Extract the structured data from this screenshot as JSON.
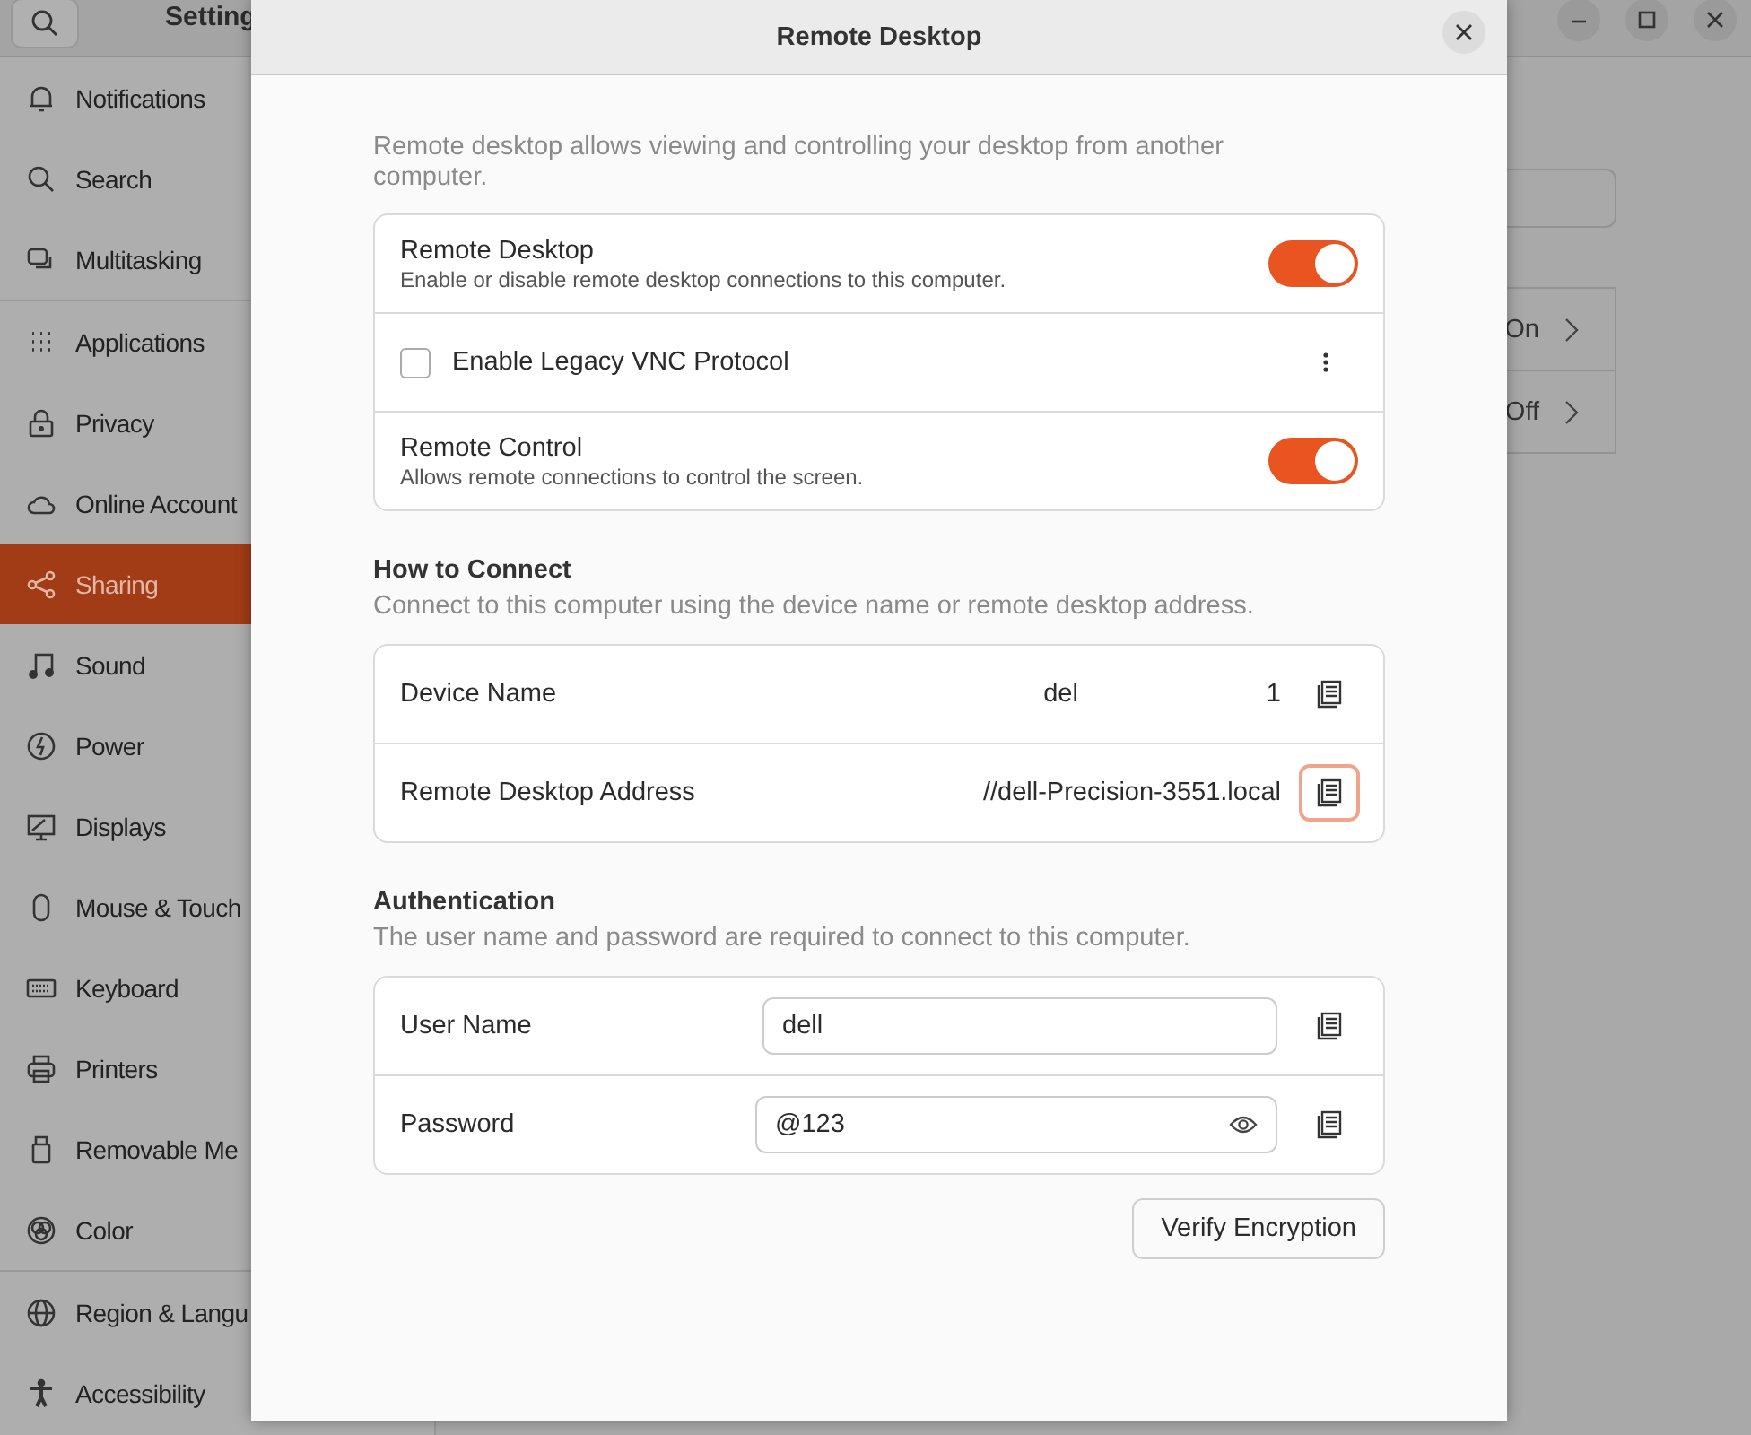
{
  "settings_window": {
    "title": "Setting",
    "sidebar": {
      "groups": [
        [
          {
            "label": "Notifications",
            "kind": "bell",
            "selected": false
          },
          {
            "label": "Search",
            "kind": "search",
            "selected": false
          },
          {
            "label": "Multitasking",
            "kind": "multitask",
            "selected": false
          }
        ],
        [
          {
            "label": "Applications",
            "kind": "grid",
            "selected": false
          },
          {
            "label": "Privacy",
            "kind": "lock",
            "selected": false
          },
          {
            "label": "Online Account",
            "kind": "cloud",
            "selected": false
          },
          {
            "label": "Sharing",
            "kind": "share",
            "selected": true
          },
          {
            "label": "Sound",
            "kind": "note",
            "selected": false
          },
          {
            "label": "Power",
            "kind": "power",
            "selected": false
          },
          {
            "label": "Displays",
            "kind": "display",
            "selected": false
          },
          {
            "label": "Mouse & Touch",
            "kind": "mouse",
            "selected": false
          },
          {
            "label": "Keyboard",
            "kind": "keyboard",
            "selected": false
          },
          {
            "label": "Printers",
            "kind": "printer",
            "selected": false
          },
          {
            "label": "Removable Me",
            "kind": "usb",
            "selected": false
          },
          {
            "label": "Color",
            "kind": "color",
            "selected": false
          }
        ],
        [
          {
            "label": "Region & Langu",
            "kind": "globe",
            "selected": false
          },
          {
            "label": "Accessibility",
            "kind": "person",
            "selected": false
          }
        ]
      ]
    },
    "panel_rows": [
      {
        "value": "On"
      },
      {
        "value": "Off"
      }
    ]
  },
  "dialog": {
    "title": "Remote Desktop",
    "intro": "Remote desktop allows viewing and controlling your desktop from another computer.",
    "options": [
      {
        "kind": "switch",
        "title": "Remote Desktop",
        "subtitle": "Enable or disable remote desktop connections to this computer.",
        "on": true
      },
      {
        "kind": "checkbox",
        "title": "Enable Legacy VNC Protocol",
        "checked": false
      },
      {
        "kind": "switch",
        "title": "Remote Control",
        "subtitle": "Allows remote connections to control the screen.",
        "on": true
      }
    ],
    "connect": {
      "heading": "How to Connect",
      "description": "Connect to this computer using the device name or remote desktop address.",
      "rows": [
        {
          "label": "Device Name",
          "value_parts": [
            "del",
            "1"
          ],
          "focused": false
        },
        {
          "label": "Remote Desktop Address",
          "value_parts": [
            "//dell-Precision-3551.local"
          ],
          "focused": true
        }
      ]
    },
    "auth": {
      "heading": "Authentication",
      "description": "The user name and password are required to connect to this computer.",
      "fields": [
        {
          "label": "User Name",
          "value": "dell",
          "kind": "text"
        },
        {
          "label": "Password",
          "value": "@123",
          "kind": "password"
        }
      ]
    },
    "button": "Verify Encryption"
  }
}
